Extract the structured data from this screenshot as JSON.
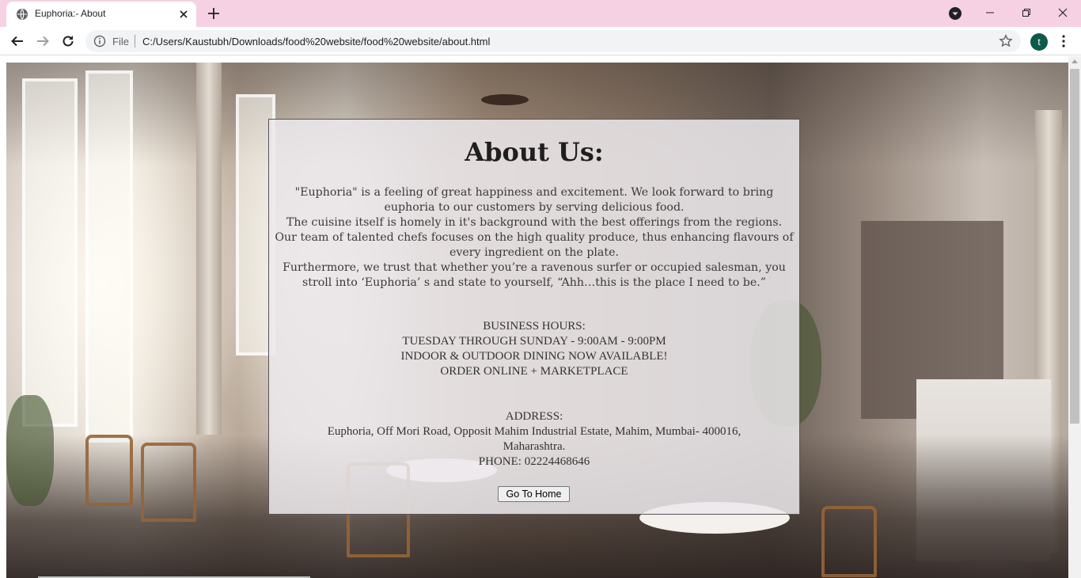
{
  "browser": {
    "tab_title": "Euphoria:- About",
    "scheme_label": "File",
    "url": "C:/Users/Kaustubh/Downloads/food%20website/food%20website/about.html",
    "avatar_letter": "t",
    "icons": {
      "favicon": "globe-icon",
      "close": "close-icon",
      "new_tab": "plus-icon",
      "back": "arrow-left-icon",
      "forward": "arrow-right-icon",
      "reload": "reload-icon",
      "info": "info-icon",
      "star": "star-icon",
      "menu": "kebab-menu-icon"
    },
    "colors": {
      "tabstrip": "#f5d1e3",
      "avatar": "#0d5a4c"
    }
  },
  "page": {
    "title": "About Us:",
    "intro_lines": [
      "\"Euphoria\" is a feeling of great happiness and excitement. We look forward to bring",
      "euphoria to our customers by serving delicious food.",
      "The cuisine itself is homely in it's background with the best offerings from the regions.",
      "Our team of talented chefs focuses on the high quality produce, thus enhancing flavours of",
      "every ingredient on the plate.",
      "Furthermore, we trust that whether you’re a ravenous surfer or occupied salesman, you",
      "stroll into ‘Euphoria’ s and state to yourself, “Ahh…this is the place I need to be.”"
    ],
    "hours_lines": [
      "BUSINESS HOURS:",
      "TUESDAY THROUGH SUNDAY - 9:00AM - 9:00PM",
      "INDOOR & OUTDOOR DINING NOW AVAILABLE!",
      "ORDER ONLINE + MARKETPLACE"
    ],
    "address_lines": [
      "ADDRESS:",
      "Euphoria, Off Mori Road, Opposit Mahim Industrial Estate, Mahim, Mumbai- 400016,",
      "Maharashtra.",
      "PHONE: 02224468646"
    ],
    "home_button_label": "Go To Home"
  }
}
